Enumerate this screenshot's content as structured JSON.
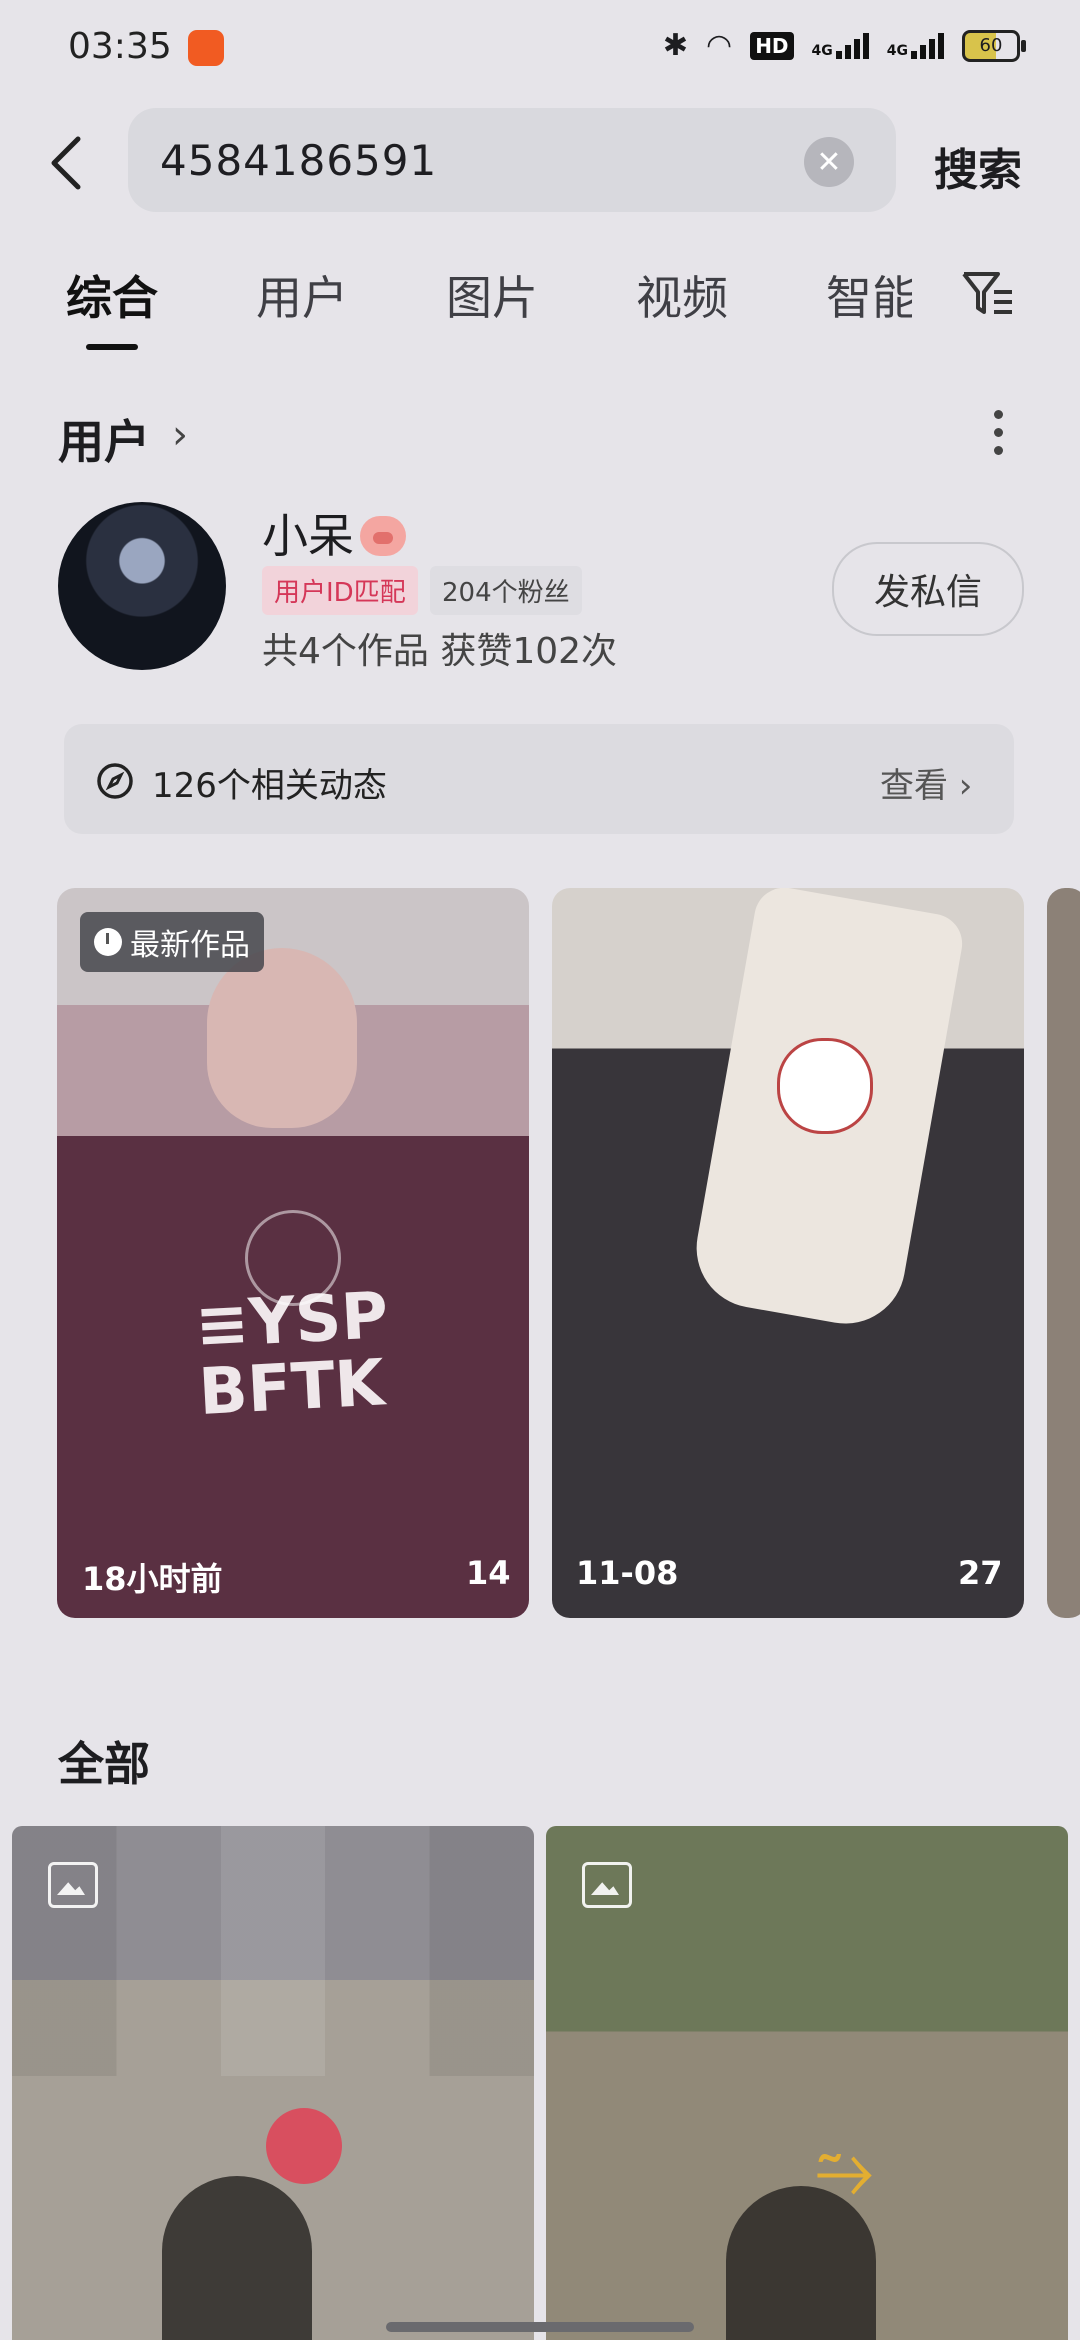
{
  "status_bar": {
    "time": "03:35",
    "network_hd": "HD",
    "net1": "4G",
    "net2": "4G",
    "battery": "60"
  },
  "search": {
    "query": "4584186591",
    "submit_label": "搜索"
  },
  "tabs": [
    "综合",
    "用户",
    "图片",
    "视频",
    "智能"
  ],
  "user_section": {
    "title": "用户",
    "name": "小呆",
    "id_match_tag": "用户ID匹配",
    "fans_tag": "204个粉丝",
    "stats": "共4个作品 获赞102次",
    "dm_label": "发私信",
    "related_feed": "126个相关动态",
    "view_label": "查看"
  },
  "works": [
    {
      "badge": "最新作品",
      "time": "18小时前",
      "count": "14"
    },
    {
      "time": "11-08",
      "count": "27"
    }
  ],
  "all_section": {
    "title": "全部"
  },
  "icons": {
    "back": "back-arrow-icon",
    "clear": "clear-icon",
    "filter": "filter-icon",
    "more": "more-vertical-icon",
    "compass": "compass-icon",
    "clock": "clock-icon",
    "gallery": "image-gallery-icon"
  },
  "colors": {
    "id_tag": "#d53758",
    "badge_bg": "#f2d3da",
    "overlay_bg": "#e6e4e9"
  }
}
